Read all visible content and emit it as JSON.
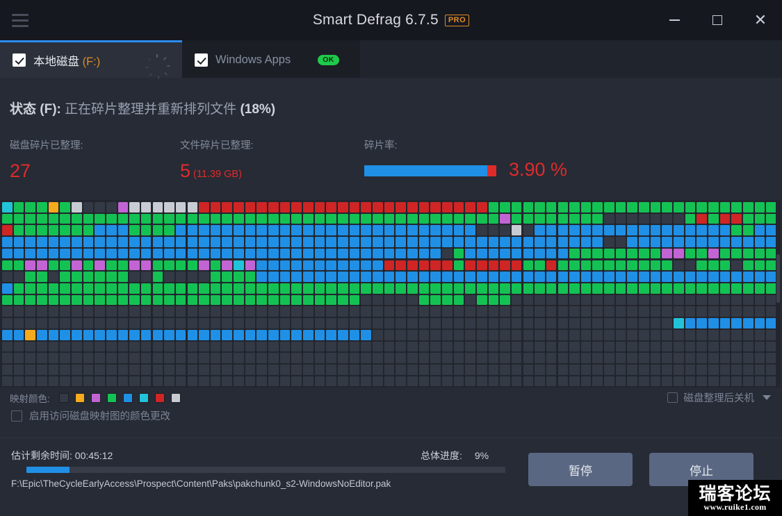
{
  "window": {
    "title": "Smart Defrag 6.7.5",
    "pro_badge": "PRO",
    "menu_icon": "hamburger-icon",
    "minimize": "minimize-icon",
    "maximize": "maximize-icon",
    "close": "close-icon"
  },
  "tabs": [
    {
      "label": "本地磁盘",
      "drive": " (F:)",
      "checked": true,
      "active": true,
      "status_icon": "spinner-icon"
    },
    {
      "label": "Windows Apps",
      "drive": "",
      "checked": true,
      "active": false,
      "badge": "OK"
    }
  ],
  "status": {
    "key": "状态 (F):",
    "text": "正在碎片整理并重新排列文件",
    "percent": "(18%)"
  },
  "stats": [
    {
      "label": "磁盘碎片已整理:",
      "value": "27",
      "sub": ""
    },
    {
      "label": "文件碎片已整理:",
      "value": "5",
      "sub": " (11.39 GB)"
    },
    {
      "label": "碎片率:",
      "value": "3.90 %",
      "bar_fill_percent": 93
    }
  ],
  "legend": {
    "label": "映射颜色:",
    "colors": [
      "#343a45",
      "#f5ab1c",
      "#c264d4",
      "#14c254",
      "#1f90e6",
      "#22c3d8",
      "#cf2525",
      "#c8ccd2"
    ],
    "names": [
      "free-space",
      "compressed",
      "directory",
      "ok-file",
      "system-file",
      "mft",
      "fragmented",
      "unmovable"
    ]
  },
  "options": {
    "color_change_label": "启用访问磁盘映射图的颜色更改",
    "color_change_checked": false,
    "shutdown_label": "磁盘整理后关机",
    "shutdown_checked": false
  },
  "footer": {
    "eta_label": "估计剩余时间:",
    "eta_value": " 00:45:12",
    "overall_label": "总体进度:",
    "overall_value": "9%",
    "progress_percent": 9,
    "current_file": "F:\\Epic\\TheCycleEarlyAccess\\Prospect\\Content\\Paks\\pakchunk0_s2-WindowsNoEditor.pak",
    "pause_button": "暂停",
    "stop_button": "停止"
  },
  "watermark": {
    "main": "瑞客论坛",
    "sub": "www.ruike1.com"
  },
  "colors": {
    "accent": "#1f90e6",
    "alert": "#e02b2b",
    "pro": "#e08b2a",
    "ok": "#1fc94b",
    "window_bg": "#272b35",
    "titlebar_bg": "#16181f"
  },
  "disk_map": {
    "columns": 67,
    "rows": 16,
    "palette": [
      "#343a45",
      "#f5ab1c",
      "#c264d4",
      "#14c254",
      "#1f90e6",
      "#22c3d8",
      "#cf2525",
      "#c8ccd2"
    ],
    "grid": [
      [
        5,
        3,
        3,
        3,
        1,
        3,
        7,
        0,
        0,
        0,
        2,
        7,
        7,
        7,
        7,
        7,
        7,
        6,
        6,
        6,
        6,
        6,
        6,
        6,
        6,
        6,
        6,
        6,
        6,
        6,
        6,
        6,
        6,
        6,
        6,
        6,
        6,
        6,
        6,
        6,
        6,
        6,
        3,
        3,
        3,
        3,
        3,
        3,
        3,
        3,
        3,
        3,
        3,
        3,
        3,
        3,
        3,
        3,
        3,
        3,
        3,
        3,
        3,
        3,
        3,
        3,
        3
      ],
      [
        3,
        3,
        3,
        3,
        3,
        3,
        3,
        3,
        3,
        3,
        3,
        3,
        3,
        3,
        3,
        3,
        3,
        3,
        3,
        3,
        3,
        3,
        3,
        3,
        3,
        3,
        3,
        3,
        3,
        3,
        3,
        3,
        3,
        3,
        3,
        3,
        3,
        3,
        3,
        3,
        3,
        3,
        3,
        2,
        3,
        3,
        3,
        3,
        3,
        3,
        3,
        3,
        0,
        0,
        0,
        0,
        0,
        0,
        0,
        3,
        6,
        3,
        6,
        6,
        3,
        3,
        3
      ],
      [
        6,
        3,
        3,
        3,
        3,
        3,
        3,
        3,
        4,
        4,
        4,
        3,
        3,
        3,
        3,
        4,
        4,
        4,
        4,
        4,
        4,
        4,
        4,
        4,
        4,
        4,
        4,
        4,
        4,
        4,
        4,
        4,
        4,
        4,
        4,
        4,
        4,
        4,
        4,
        4,
        4,
        0,
        0,
        0,
        7,
        0,
        4,
        4,
        4,
        4,
        4,
        4,
        4,
        4,
        4,
        4,
        4,
        4,
        4,
        4,
        4,
        4,
        4,
        3,
        3,
        4,
        4
      ],
      [
        4,
        4,
        4,
        4,
        4,
        4,
        4,
        4,
        4,
        4,
        4,
        4,
        4,
        4,
        4,
        4,
        4,
        4,
        4,
        4,
        4,
        4,
        4,
        4,
        4,
        4,
        4,
        4,
        4,
        4,
        4,
        4,
        4,
        4,
        4,
        4,
        4,
        4,
        4,
        4,
        4,
        4,
        4,
        4,
        4,
        4,
        4,
        4,
        4,
        4,
        4,
        4,
        0,
        0,
        4,
        4,
        4,
        4,
        4,
        4,
        4,
        4,
        4,
        4,
        4,
        4,
        4
      ],
      [
        4,
        4,
        4,
        4,
        4,
        4,
        4,
        4,
        4,
        4,
        4,
        4,
        4,
        4,
        4,
        4,
        4,
        4,
        4,
        4,
        4,
        4,
        4,
        4,
        4,
        4,
        4,
        4,
        4,
        4,
        4,
        4,
        4,
        4,
        4,
        4,
        4,
        4,
        0,
        3,
        4,
        4,
        4,
        4,
        4,
        4,
        4,
        4,
        4,
        3,
        3,
        3,
        3,
        3,
        3,
        3,
        3,
        2,
        2,
        3,
        3,
        2,
        3,
        3,
        3,
        3,
        3
      ],
      [
        3,
        3,
        2,
        2,
        3,
        3,
        2,
        3,
        2,
        3,
        3,
        2,
        2,
        3,
        3,
        3,
        3,
        2,
        3,
        2,
        5,
        2,
        4,
        4,
        4,
        4,
        4,
        4,
        4,
        4,
        4,
        4,
        4,
        6,
        6,
        6,
        6,
        6,
        6,
        3,
        6,
        6,
        6,
        6,
        6,
        3,
        3,
        6,
        3,
        3,
        3,
        3,
        3,
        3,
        3,
        3,
        3,
        3,
        0,
        0,
        3,
        3,
        3,
        0,
        3,
        3,
        3
      ],
      [
        0,
        0,
        3,
        3,
        0,
        3,
        3,
        3,
        3,
        3,
        3,
        0,
        0,
        3,
        0,
        0,
        0,
        0,
        3,
        3,
        3,
        3,
        4,
        4,
        4,
        4,
        4,
        4,
        4,
        4,
        4,
        4,
        4,
        4,
        4,
        4,
        4,
        4,
        4,
        4,
        4,
        4,
        4,
        4,
        4,
        4,
        4,
        4,
        4,
        4,
        4,
        4,
        4,
        4,
        4,
        4,
        4,
        4,
        4,
        4,
        4,
        4,
        4,
        4,
        4,
        4,
        4
      ],
      [
        4,
        3,
        3,
        3,
        3,
        3,
        3,
        3,
        3,
        3,
        3,
        3,
        3,
        3,
        3,
        3,
        3,
        3,
        3,
        3,
        3,
        3,
        3,
        3,
        3,
        3,
        3,
        3,
        3,
        3,
        3,
        3,
        3,
        3,
        3,
        3,
        3,
        3,
        3,
        3,
        3,
        3,
        3,
        3,
        3,
        3,
        3,
        3,
        3,
        3,
        3,
        3,
        3,
        3,
        3,
        3,
        3,
        3,
        3,
        3,
        3,
        3,
        3,
        3,
        3,
        3,
        3
      ],
      [
        3,
        3,
        3,
        3,
        3,
        3,
        3,
        3,
        3,
        3,
        3,
        3,
        3,
        3,
        3,
        3,
        3,
        3,
        3,
        3,
        3,
        3,
        3,
        3,
        3,
        3,
        3,
        3,
        3,
        3,
        3,
        0,
        0,
        0,
        0,
        0,
        3,
        3,
        3,
        3,
        0,
        3,
        3,
        3,
        0,
        0,
        0,
        0,
        0,
        0,
        0,
        0,
        0,
        0,
        0,
        0,
        0,
        0,
        0,
        0,
        0,
        0,
        0,
        0,
        0,
        0,
        0
      ],
      [
        0,
        0,
        0,
        0,
        0,
        0,
        0,
        0,
        0,
        0,
        0,
        0,
        0,
        0,
        0,
        0,
        0,
        0,
        0,
        0,
        0,
        0,
        0,
        0,
        0,
        0,
        0,
        0,
        0,
        0,
        0,
        0,
        0,
        0,
        0,
        0,
        0,
        0,
        0,
        0,
        0,
        0,
        0,
        0,
        0,
        0,
        0,
        0,
        0,
        0,
        0,
        0,
        0,
        0,
        0,
        0,
        0,
        0,
        0,
        0,
        0,
        0,
        0,
        0,
        0,
        0,
        0
      ],
      [
        0,
        0,
        0,
        0,
        0,
        0,
        0,
        0,
        0,
        0,
        0,
        0,
        0,
        0,
        0,
        0,
        0,
        0,
        0,
        0,
        0,
        0,
        0,
        0,
        0,
        0,
        0,
        0,
        0,
        0,
        0,
        0,
        0,
        0,
        0,
        0,
        0,
        0,
        0,
        0,
        0,
        0,
        0,
        0,
        0,
        0,
        0,
        0,
        0,
        0,
        0,
        0,
        0,
        0,
        0,
        0,
        0,
        0,
        5,
        4,
        4,
        4,
        4,
        4,
        4,
        4,
        4
      ],
      [
        4,
        4,
        1,
        4,
        4,
        4,
        4,
        4,
        4,
        4,
        4,
        4,
        4,
        4,
        4,
        4,
        4,
        4,
        4,
        4,
        4,
        4,
        4,
        4,
        4,
        4,
        4,
        4,
        4,
        4,
        4,
        4,
        0,
        0,
        0,
        0,
        0,
        0,
        0,
        0,
        0,
        0,
        0,
        0,
        0,
        0,
        0,
        0,
        0,
        0,
        0,
        0,
        0,
        0,
        0,
        0,
        0,
        0,
        0,
        0,
        0,
        0,
        0,
        0,
        0,
        0,
        0
      ],
      [
        0,
        0,
        0,
        0,
        0,
        0,
        0,
        0,
        0,
        0,
        0,
        0,
        0,
        0,
        0,
        0,
        0,
        0,
        0,
        0,
        0,
        0,
        0,
        0,
        0,
        0,
        0,
        0,
        0,
        0,
        0,
        0,
        0,
        0,
        0,
        0,
        0,
        0,
        0,
        0,
        0,
        0,
        0,
        0,
        0,
        0,
        0,
        0,
        0,
        0,
        0,
        0,
        0,
        0,
        0,
        0,
        0,
        0,
        0,
        0,
        0,
        0,
        0,
        0,
        0,
        0,
        0
      ],
      [
        0,
        0,
        0,
        0,
        0,
        0,
        0,
        0,
        0,
        0,
        0,
        0,
        0,
        0,
        0,
        0,
        0,
        0,
        0,
        0,
        0,
        0,
        0,
        0,
        0,
        0,
        0,
        0,
        0,
        0,
        0,
        0,
        0,
        0,
        0,
        0,
        0,
        0,
        0,
        0,
        0,
        0,
        0,
        0,
        0,
        0,
        0,
        0,
        0,
        0,
        0,
        0,
        0,
        0,
        0,
        0,
        0,
        0,
        0,
        0,
        0,
        0,
        0,
        0,
        0,
        0,
        0
      ],
      [
        0,
        0,
        0,
        0,
        0,
        0,
        0,
        0,
        0,
        0,
        0,
        0,
        0,
        0,
        0,
        0,
        0,
        0,
        0,
        0,
        0,
        0,
        0,
        0,
        0,
        0,
        0,
        0,
        0,
        0,
        0,
        0,
        0,
        0,
        0,
        0,
        0,
        0,
        0,
        0,
        0,
        0,
        0,
        0,
        0,
        0,
        0,
        0,
        0,
        0,
        0,
        0,
        0,
        0,
        0,
        0,
        0,
        0,
        0,
        0,
        0,
        0,
        0,
        0,
        0,
        0,
        0
      ],
      [
        0,
        0,
        0,
        0,
        0,
        0,
        0,
        0,
        0,
        0,
        0,
        0,
        0,
        0,
        0,
        0,
        0,
        0,
        0,
        0,
        0,
        0,
        0,
        0,
        0,
        0,
        0,
        0,
        0,
        0,
        0,
        0,
        0,
        0,
        0,
        0,
        0,
        0,
        0,
        0,
        0,
        0,
        0,
        0,
        0,
        0,
        0,
        0,
        0,
        0,
        0,
        0,
        0,
        0,
        0,
        0,
        0,
        0,
        0,
        0,
        0,
        0,
        0,
        0,
        0,
        0,
        0
      ]
    ]
  }
}
